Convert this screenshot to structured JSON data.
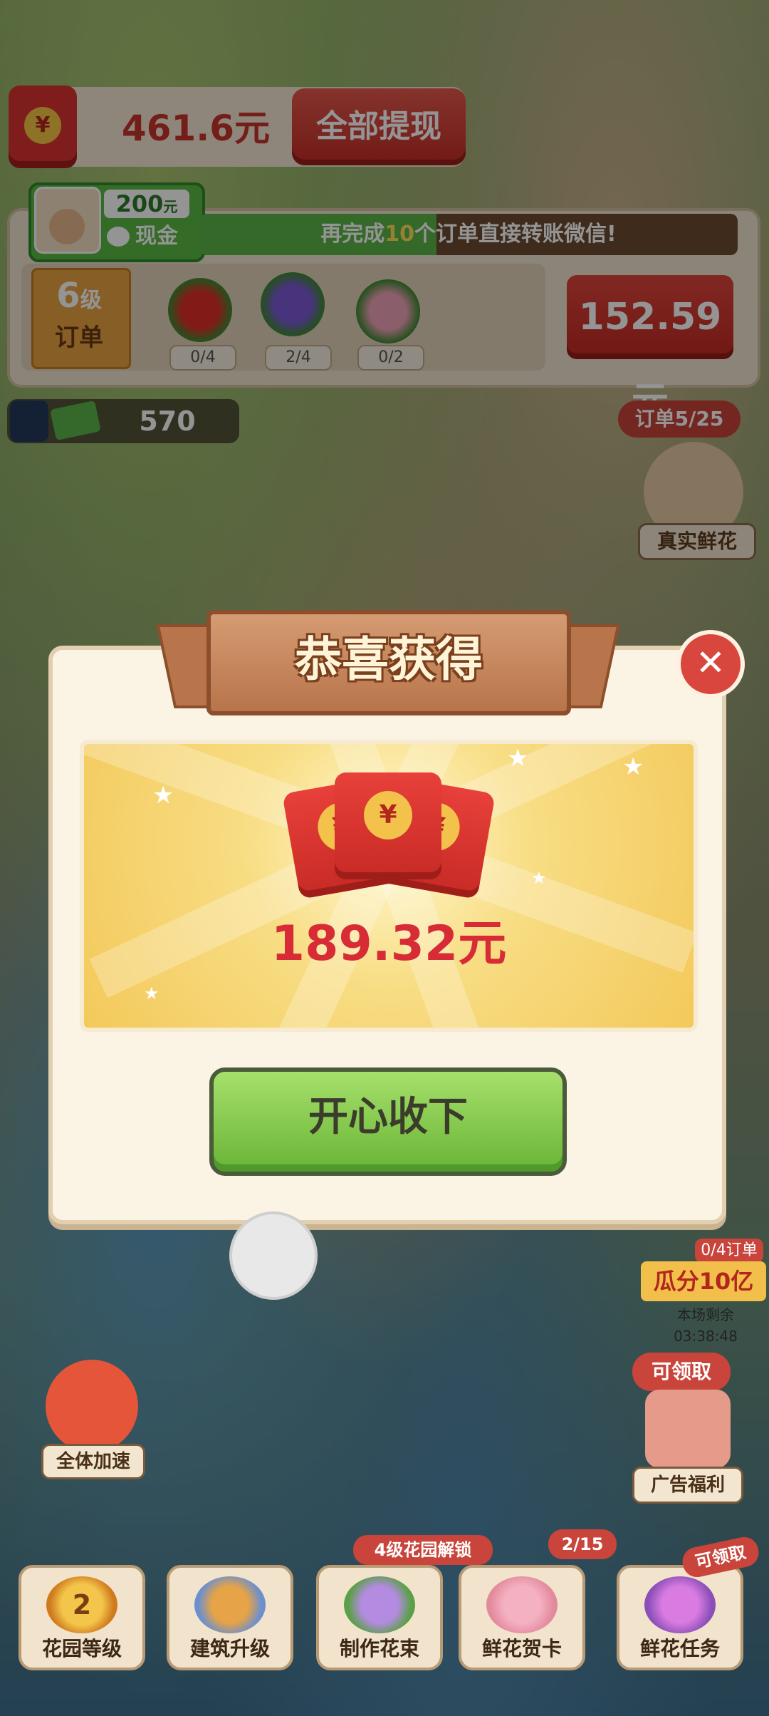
{
  "colors": {
    "accent_red": "#c9443a",
    "accent_green": "#69b436",
    "prize_red": "#d72b36",
    "gold": "#f2c24b"
  },
  "top": {
    "redpack_icon": "red-envelope-icon",
    "currency_symbol": "¥",
    "balance": "461.6元",
    "withdraw_label": "全部提现"
  },
  "cash_chip": {
    "amount": "200",
    "amount_unit": "元",
    "label": "现金"
  },
  "order_tip": {
    "prefix": "再完成",
    "count": "10",
    "suffix": "个订单直接转账微信!",
    "progress": 0.44
  },
  "level": {
    "number": "6",
    "unit": "级",
    "label": "订单"
  },
  "flowers": [
    {
      "icon": "red-rose-icon",
      "count": "0/4"
    },
    {
      "icon": "purple-flower-icon",
      "count": "2/4"
    },
    {
      "icon": "pink-flower-icon",
      "count": "0/2"
    }
  ],
  "order_reward": "152.59元",
  "coins": {
    "value": "570"
  },
  "order_progress": "订单5/25",
  "real_flower_label": "真实鲜花",
  "modal": {
    "title": "恭喜获得",
    "close_glyph": "✕",
    "prize_amount": "189.32元",
    "accept_label": "开心收下"
  },
  "event": {
    "tag": "0/4订单",
    "banner": "瓜分10亿",
    "timer": "本场剩余 03:38:48"
  },
  "speed_label": "全体加速",
  "ad": {
    "claim": "可领取",
    "label": "广告福利"
  },
  "nav": [
    {
      "label": "花园等级",
      "badge": "2",
      "icon": "medal-icon"
    },
    {
      "label": "建筑升级",
      "icon": "building-icon"
    },
    {
      "label": "制作花束",
      "flag": "4级花园解锁",
      "icon": "bouquet-icon"
    },
    {
      "label": "鲜花贺卡",
      "flag": "2/15",
      "icon": "card-icon"
    },
    {
      "label": "鲜花任务",
      "flag": "可领取",
      "icon": "task-book-icon"
    }
  ]
}
